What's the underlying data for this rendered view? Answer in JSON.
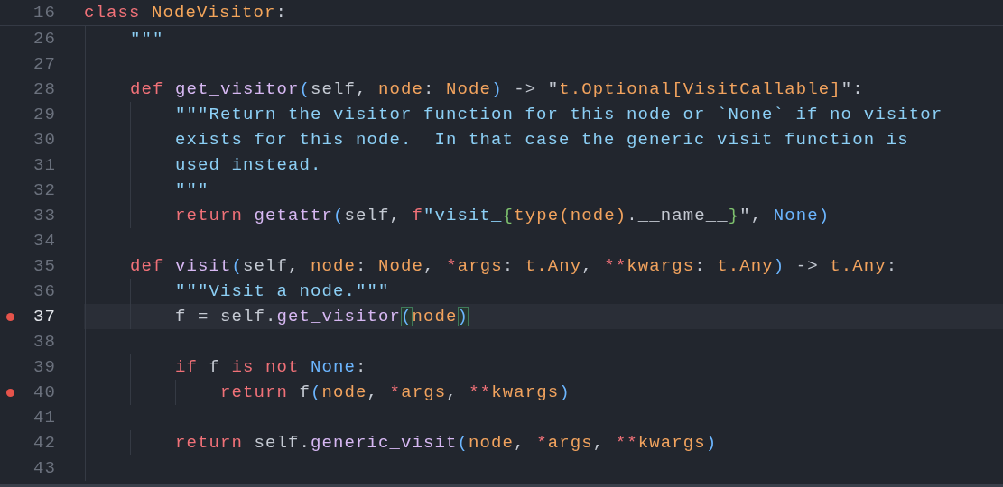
{
  "sticky_line": {
    "number": "16",
    "tokens": [
      {
        "text": "class",
        "kind": "keyword"
      },
      {
        "text": " NodeVisitor",
        "kind": "class"
      },
      {
        "text": ":",
        "kind": "plain"
      }
    ]
  },
  "lines": [
    {
      "number": "26",
      "breakpoint": false,
      "current": false,
      "tokens": [
        {
          "text": "    \"\"\"",
          "kind": "doc"
        }
      ]
    },
    {
      "number": "27",
      "breakpoint": false,
      "current": false
    },
    {
      "number": "28",
      "breakpoint": false,
      "current": false,
      "tokens": [
        {
          "text": "    def",
          "kind": "keyword"
        },
        {
          "text": " get_visitor",
          "kind": "function"
        },
        {
          "text": "(",
          "kind": "paren"
        },
        {
          "text": "self, ",
          "kind": "plain"
        },
        {
          "text": "node",
          "kind": "param"
        },
        {
          "text": ": ",
          "kind": "plain"
        },
        {
          "text": "Node",
          "kind": "param"
        },
        {
          "text": ")",
          "kind": "paren"
        },
        {
          "text": " -> \"",
          "kind": "plain"
        },
        {
          "text": "t.Optional[VisitCallable]",
          "kind": "param"
        },
        {
          "text": "\":",
          "kind": "plain"
        }
      ]
    },
    {
      "number": "29",
      "breakpoint": false,
      "current": false,
      "tokens": [
        {
          "text": "        \"\"\"Return the visitor function for this node or `None` if no visitor",
          "kind": "doc"
        }
      ]
    },
    {
      "number": "30",
      "breakpoint": false,
      "current": false,
      "tokens": [
        {
          "text": "        exists for this node.  In that case the generic visit function is",
          "kind": "doc"
        }
      ]
    },
    {
      "number": "31",
      "breakpoint": false,
      "current": false,
      "tokens": [
        {
          "text": "        used instead.",
          "kind": "doc"
        }
      ]
    },
    {
      "number": "32",
      "breakpoint": false,
      "current": false,
      "tokens": [
        {
          "text": "        \"\"\"",
          "kind": "doc"
        }
      ]
    },
    {
      "number": "33",
      "breakpoint": false,
      "current": false,
      "tokens": [
        {
          "text": "        return",
          "kind": "keyword"
        },
        {
          "text": " getattr",
          "kind": "function"
        },
        {
          "text": "(",
          "kind": "paren"
        },
        {
          "text": "self, ",
          "kind": "plain"
        },
        {
          "text": "f",
          "kind": "keyword"
        },
        {
          "text": "\"visit_",
          "kind": "doc"
        },
        {
          "text": "{",
          "kind": "brace"
        },
        {
          "text": "type(node)",
          "kind": "param"
        },
        {
          "text": ".__name__",
          "kind": "plain"
        },
        {
          "text": "}",
          "kind": "brace"
        },
        {
          "text": "\", ",
          "kind": "plain"
        },
        {
          "text": "None",
          "kind": "constant"
        },
        {
          "text": ")",
          "kind": "paren"
        }
      ]
    },
    {
      "number": "34",
      "breakpoint": false,
      "current": false
    },
    {
      "number": "35",
      "breakpoint": false,
      "current": false,
      "tokens": [
        {
          "text": "    def",
          "kind": "keyword"
        },
        {
          "text": " visit",
          "kind": "function"
        },
        {
          "text": "(",
          "kind": "paren"
        },
        {
          "text": "self, ",
          "kind": "plain"
        },
        {
          "text": "node",
          "kind": "param"
        },
        {
          "text": ": ",
          "kind": "plain"
        },
        {
          "text": "Node",
          "kind": "param"
        },
        {
          "text": ", ",
          "kind": "plain"
        },
        {
          "text": "*",
          "kind": "keyword"
        },
        {
          "text": "args",
          "kind": "param"
        },
        {
          "text": ": ",
          "kind": "plain"
        },
        {
          "text": "t.Any",
          "kind": "param"
        },
        {
          "text": ", ",
          "kind": "plain"
        },
        {
          "text": "**",
          "kind": "keyword"
        },
        {
          "text": "kwargs",
          "kind": "param"
        },
        {
          "text": ": ",
          "kind": "plain"
        },
        {
          "text": "t.Any",
          "kind": "param"
        },
        {
          "text": ")",
          "kind": "paren"
        },
        {
          "text": " -> ",
          "kind": "plain"
        },
        {
          "text": "t.Any",
          "kind": "param"
        },
        {
          "text": ":",
          "kind": "plain"
        }
      ]
    },
    {
      "number": "36",
      "breakpoint": false,
      "current": false,
      "tokens": [
        {
          "text": "        \"\"\"Visit a node.\"\"\"",
          "kind": "doc"
        }
      ]
    },
    {
      "number": "37",
      "breakpoint": true,
      "current": true,
      "tokens": [
        {
          "text": "        f = self.",
          "kind": "plain"
        },
        {
          "text": "get_visitor",
          "kind": "function"
        },
        {
          "text": "(",
          "kind": "paren",
          "matched": true
        },
        {
          "text": "node",
          "kind": "param"
        },
        {
          "text": ")",
          "kind": "paren",
          "matched": true
        }
      ]
    },
    {
      "number": "38",
      "breakpoint": false,
      "current": false
    },
    {
      "number": "39",
      "breakpoint": false,
      "current": false,
      "tokens": [
        {
          "text": "        if",
          "kind": "keyword"
        },
        {
          "text": " f ",
          "kind": "plain"
        },
        {
          "text": "is not",
          "kind": "keyword"
        },
        {
          "text": " None",
          "kind": "constant"
        },
        {
          "text": ":",
          "kind": "plain"
        }
      ]
    },
    {
      "number": "40",
      "breakpoint": true,
      "current": false,
      "tokens": [
        {
          "text": "            return",
          "kind": "keyword"
        },
        {
          "text": " f",
          "kind": "plain"
        },
        {
          "text": "(",
          "kind": "paren"
        },
        {
          "text": "node",
          "kind": "param"
        },
        {
          "text": ", ",
          "kind": "plain"
        },
        {
          "text": "*",
          "kind": "keyword"
        },
        {
          "text": "args",
          "kind": "param"
        },
        {
          "text": ", ",
          "kind": "plain"
        },
        {
          "text": "**",
          "kind": "keyword"
        },
        {
          "text": "kwargs",
          "kind": "param"
        },
        {
          "text": ")",
          "kind": "paren"
        }
      ]
    },
    {
      "number": "41",
      "breakpoint": false,
      "current": false
    },
    {
      "number": "42",
      "breakpoint": false,
      "current": false,
      "tokens": [
        {
          "text": "        return",
          "kind": "keyword"
        },
        {
          "text": " self.",
          "kind": "plain"
        },
        {
          "text": "generic_visit",
          "kind": "function"
        },
        {
          "text": "(",
          "kind": "paren"
        },
        {
          "text": "node",
          "kind": "param"
        },
        {
          "text": ", ",
          "kind": "plain"
        },
        {
          "text": "*",
          "kind": "keyword"
        },
        {
          "text": "args",
          "kind": "param"
        },
        {
          "text": ", ",
          "kind": "plain"
        },
        {
          "text": "**",
          "kind": "keyword"
        },
        {
          "text": "kwargs",
          "kind": "param"
        },
        {
          "text": ")",
          "kind": "paren"
        }
      ]
    },
    {
      "number": "43",
      "breakpoint": false,
      "current": false
    }
  ]
}
